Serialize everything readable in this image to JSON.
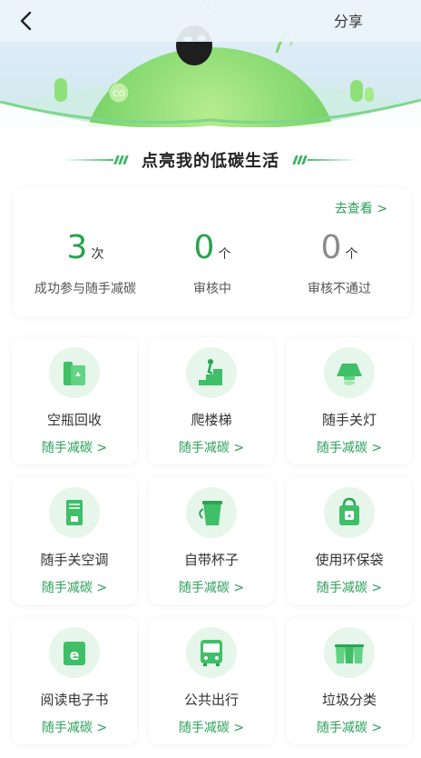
{
  "header": {
    "share_label": "分享"
  },
  "section": {
    "title": "点亮我的低碳生活"
  },
  "stats": {
    "view_link": "去查看 >",
    "items": [
      {
        "value": "3",
        "unit": "次",
        "label": "成功参与随手减碳"
      },
      {
        "value": "0",
        "unit": "个",
        "label": "审核中"
      },
      {
        "value": "0",
        "unit": "个",
        "label": "审核不通过"
      }
    ]
  },
  "actions": [
    {
      "name": "空瓶回收",
      "action": "随手减碳 >",
      "icon": "recycle-bottle-icon"
    },
    {
      "name": "爬楼梯",
      "action": "随手减碳 >",
      "icon": "stairs-icon"
    },
    {
      "name": "随手关灯",
      "action": "随手减碳 >",
      "icon": "lamp-icon"
    },
    {
      "name": "随手关空调",
      "action": "随手减碳 >",
      "icon": "air-conditioner-icon"
    },
    {
      "name": "自带杯子",
      "action": "随手减碳 >",
      "icon": "cup-icon"
    },
    {
      "name": "使用环保袋",
      "action": "随手减碳 >",
      "icon": "eco-bag-icon"
    },
    {
      "name": "阅读电子书",
      "action": "随手减碳 >",
      "icon": "ebook-icon"
    },
    {
      "name": "公共出行",
      "action": "随手减碳 >",
      "icon": "bus-icon"
    },
    {
      "name": "垃圾分类",
      "action": "随手减碳 >",
      "icon": "trash-bins-icon"
    }
  ],
  "colors": {
    "accent": "#2ca05a",
    "number_green": "#26a34b",
    "number_gray": "#8a8a8a",
    "icon_bg": "#e6f6ea"
  }
}
